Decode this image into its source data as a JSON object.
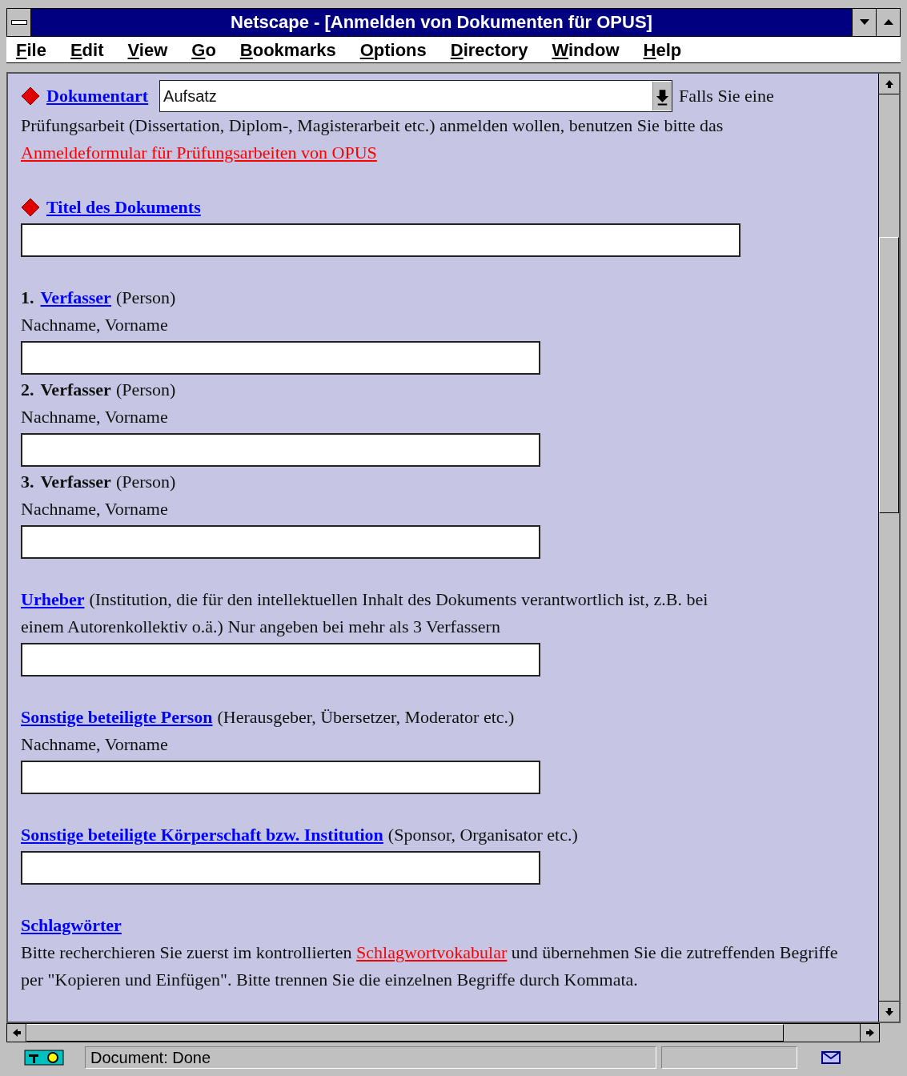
{
  "window": {
    "title": "Netscape - [Anmelden von Dokumenten für OPUS]"
  },
  "menu": [
    "File",
    "Edit",
    "View",
    "Go",
    "Bookmarks",
    "Options",
    "Directory",
    "Window",
    "Help"
  ],
  "groups": [
    {
      "items": [
        {
          "kind": "select",
          "required": true,
          "linked": true,
          "label": "Dokumentart",
          "value": "Aufsatz",
          "trailing": "Falls Sie eine",
          "note": {
            "before": "Prüfungsarbeit (Dissertation, Diplom-, Magisterarbeit etc.) anmelden wollen, benutzen Sie bitte das ",
            "link": "Anmeldeformular für Prüfungsarbeiten von OPUS"
          }
        }
      ]
    },
    {
      "items": [
        {
          "kind": "input",
          "required": true,
          "linked": true,
          "label": "Titel des Dokuments",
          "wide": true
        }
      ]
    },
    {
      "items": [
        {
          "kind": "input",
          "required": false,
          "linked": true,
          "number": "1.",
          "label": "Verfasser",
          "suffix": "(Person)",
          "hint": "Nachname, Vorname",
          "wide": false
        },
        {
          "kind": "input",
          "required": false,
          "linked": false,
          "number": "2.",
          "label": "Verfasser",
          "suffix": "(Person)",
          "hint": "Nachname, Vorname",
          "wide": false
        },
        {
          "kind": "input",
          "required": false,
          "linked": false,
          "number": "3.",
          "label": "Verfasser",
          "suffix": "(Person)",
          "hint": "Nachname, Vorname",
          "wide": false
        }
      ]
    },
    {
      "items": [
        {
          "kind": "input",
          "required": false,
          "linked": true,
          "label": "Urheber",
          "suffix": "(Institution, die für den intellektuellen Inhalt des Dokuments verantwortlich ist, z.B. bei",
          "suffix_continued": "einem Autorenkollektiv o.ä.) Nur angeben bei mehr als 3 Verfassern",
          "wide": false
        }
      ]
    },
    {
      "items": [
        {
          "kind": "input",
          "required": false,
          "linked": true,
          "label": "Sonstige beteiligte Person",
          "suffix": "(Herausgeber, Übersetzer, Moderator etc.)",
          "hint": "Nachname, Vorname",
          "wide": false
        }
      ]
    },
    {
      "items": [
        {
          "kind": "input",
          "required": false,
          "linked": true,
          "label": "Sonstige beteiligte Körperschaft bzw. Institution",
          "suffix": "(Sponsor, Organisator etc.)",
          "wide": false
        }
      ]
    },
    {
      "items": [
        {
          "kind": "text",
          "required": false,
          "linked": true,
          "label": "Schlagwörter",
          "note": {
            "before": "Bitte recherchieren Sie zuerst im kontrollierten ",
            "link": "Schlagwortvokabular",
            "after": " und übernehmen Sie die zutreffenden Begriffe per \"Kopieren und Einfügen\". Bitte trennen Sie die einzelnen Begriffe durch Kommata."
          }
        }
      ]
    }
  ],
  "status_bar": {
    "text": "Document: Done"
  }
}
